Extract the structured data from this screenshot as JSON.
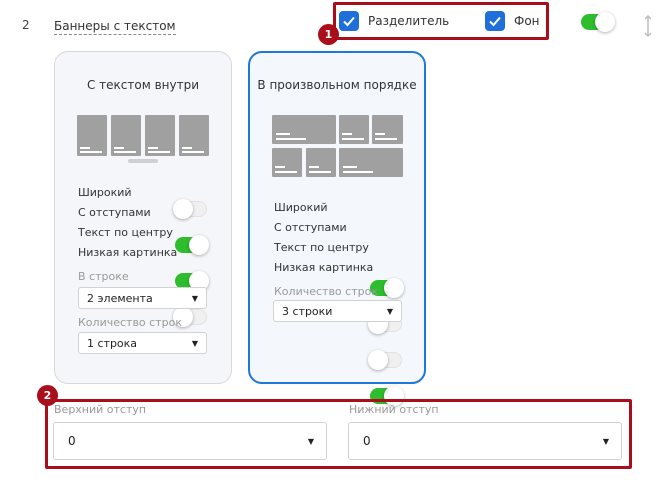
{
  "row": {
    "number": "2",
    "title": "Баннеры с текстом"
  },
  "callouts": {
    "one": "1",
    "two": "2"
  },
  "header_options": {
    "separator_label": "Разделитель",
    "background_label": "Фон"
  },
  "cards": [
    {
      "title": "С текстом внутри",
      "options": [
        {
          "label": "Широкий",
          "on": false
        },
        {
          "label": "С отступами",
          "on": true
        },
        {
          "label": "Текст по центру",
          "on": true
        },
        {
          "label": "Низкая картинка",
          "on": false
        }
      ],
      "per_row_label": "В строке",
      "per_row_value": "2 элемента",
      "rows_label": "Количество строк",
      "rows_value": "1 строка"
    },
    {
      "title": "В произвольном порядке",
      "options": [
        {
          "label": "Широкий",
          "on": true
        },
        {
          "label": "С отступами",
          "on": false
        },
        {
          "label": "Текст по центру",
          "on": false
        },
        {
          "label": "Низкая картинка",
          "on": true
        }
      ],
      "rows_label": "Количество строк",
      "rows_value": "3 строки"
    }
  ],
  "padding": {
    "top_label": "Верхний отступ",
    "top_value": "0",
    "bottom_label": "Нижний отступ",
    "bottom_value": "0"
  },
  "colors": {
    "accent": "#1e6fd9",
    "toggle_on": "#2dbd2d",
    "callout": "#a80f1a"
  }
}
